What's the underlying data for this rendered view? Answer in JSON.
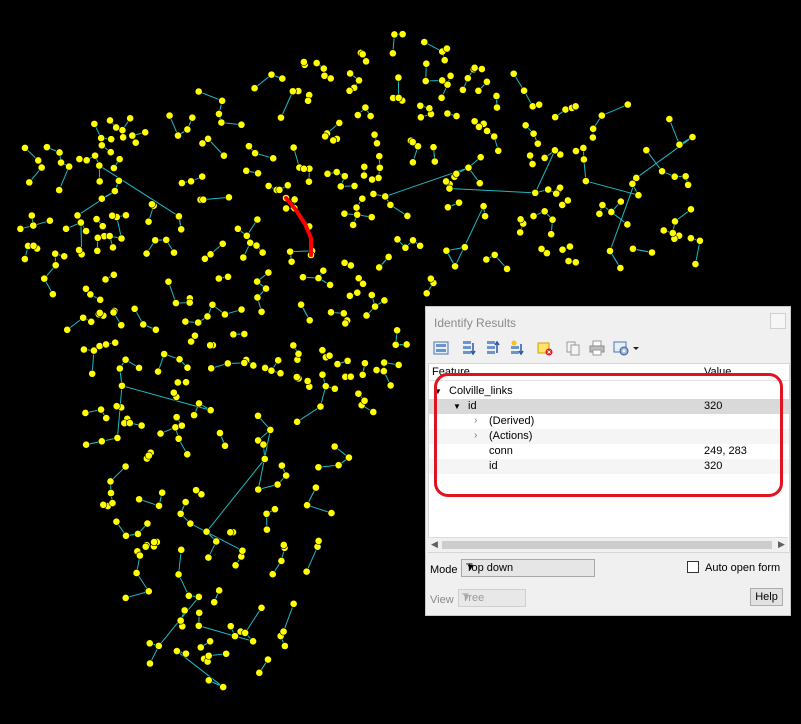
{
  "colors": {
    "background": "#000000",
    "link_line": "#1fb9c4",
    "node_fill": "#ffff00",
    "selected_link": "#ff0000",
    "annotation": "#e0141e"
  },
  "identify": {
    "title": "Identify Results",
    "columns": {
      "feature": "Feature",
      "value": "Value"
    },
    "rows": [
      {
        "label": "Colville_links",
        "value": ""
      },
      {
        "label": "id",
        "value": "320"
      },
      {
        "label": "(Derived)",
        "value": ""
      },
      {
        "label": "(Actions)",
        "value": ""
      },
      {
        "label": "conn",
        "value": "249, 283"
      },
      {
        "label": "id",
        "value": "320"
      }
    ],
    "mode_label": "Mode",
    "mode_value": "Top down",
    "auto_open_label": "Auto open form",
    "view_label": "View",
    "view_value": "Tree",
    "help_label": "Help"
  },
  "toolbar_icons": [
    "form-view-icon",
    "expand-tree-icon",
    "collapse-tree-icon",
    "expand-new-icon",
    "clear-results-icon",
    "copy-icon",
    "print-icon",
    "settings-icon",
    "dropdown-arrow-icon"
  ]
}
